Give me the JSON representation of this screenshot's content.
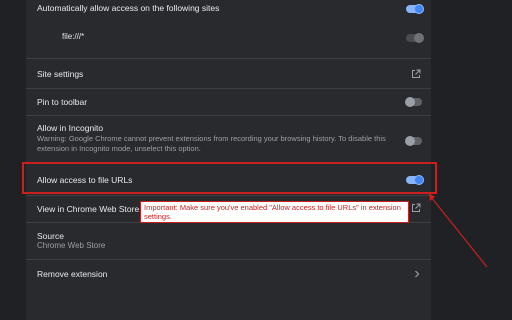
{
  "settings": {
    "auto_allow_label": "Automatically allow access on the following sites",
    "site_pattern": "file:///*",
    "site_settings_label": "Site settings",
    "pin_toolbar_label": "Pin to toolbar",
    "incognito_label": "Allow in Incognito",
    "incognito_warning": "Warning: Google Chrome cannot prevent extensions from recording your browsing history. To disable this extension in Incognito mode, unselect this option.",
    "file_urls_label": "Allow access to file URLs",
    "web_store_label": "View in Chrome Web Store",
    "source_label": "Source",
    "source_value": "Chrome Web Store",
    "remove_label": "Remove extension"
  },
  "toggles": {
    "auto_allow": "on",
    "site_pattern": "on-disabled",
    "pin_toolbar": "off",
    "incognito": "off",
    "file_urls": "on"
  },
  "annotation": {
    "callout_text": "Important: Make sure you've enabled \"Allow access to file URLs\" in extension settings.",
    "color": "#cc1f1f"
  },
  "icons": {
    "site_settings": "external-link-icon",
    "web_store": "external-link-icon",
    "remove": "chevron-right-icon"
  },
  "colors": {
    "accent": "#8ab4f8",
    "panel": "#292a2d",
    "background": "#202124"
  }
}
